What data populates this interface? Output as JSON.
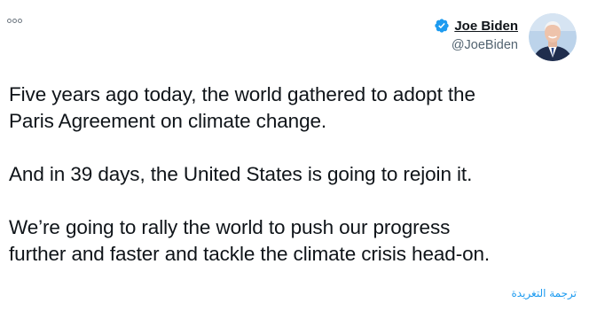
{
  "tweet": {
    "author": {
      "display_name": "Joe Biden",
      "handle": "@JoeBiden",
      "verified": true,
      "verified_icon": "verified-badge-icon",
      "avatar_icon": "profile-avatar"
    },
    "more_icon": "more-options-icon",
    "paragraphs": [
      "Five years ago today, the world gathered to adopt the\nParis Agreement on climate change.",
      "And in 39 days, the United States is going to rejoin it.",
      "We’re going to rally the world to push our progress\nfurther and faster and tackle the climate crisis head-on."
    ],
    "translate_label": "ترجمة التغريدة"
  },
  "colors": {
    "accent": "#1d9bf0",
    "text": "#0f1419",
    "secondary": "#536471"
  }
}
